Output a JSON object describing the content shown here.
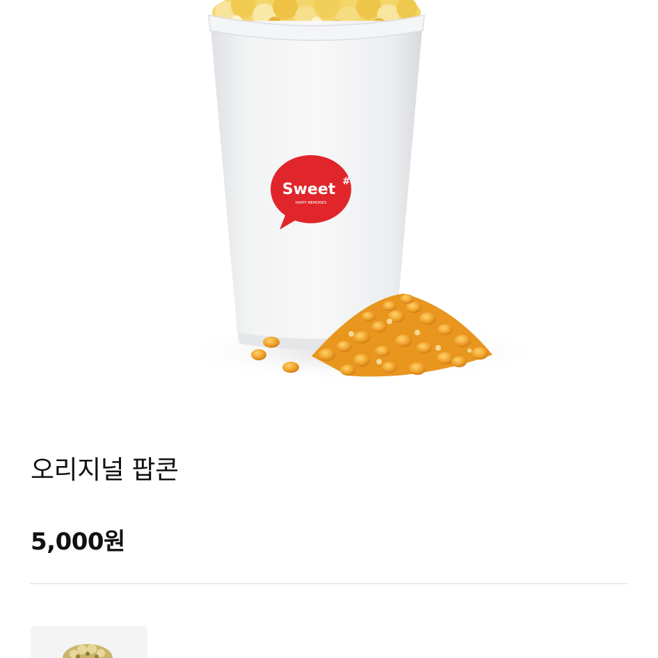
{
  "product": {
    "image_icon": "popcorn-cup-image",
    "cup_logo_text": "Sweet",
    "cup_logo_mark": "#",
    "cup_logo_tagline": "HAPPY MEMORIES",
    "name": "오리지널 팝콘",
    "price": "5,000원"
  },
  "option_thumbnail": {
    "icon": "popcorn-thumbnail-image"
  },
  "colors": {
    "background": "#ffffff",
    "text": "#111111",
    "divider": "#ececec",
    "logo_red": "#e0262b",
    "popcorn_yellow": "#f1c84b",
    "kernel_orange": "#e8961e"
  }
}
